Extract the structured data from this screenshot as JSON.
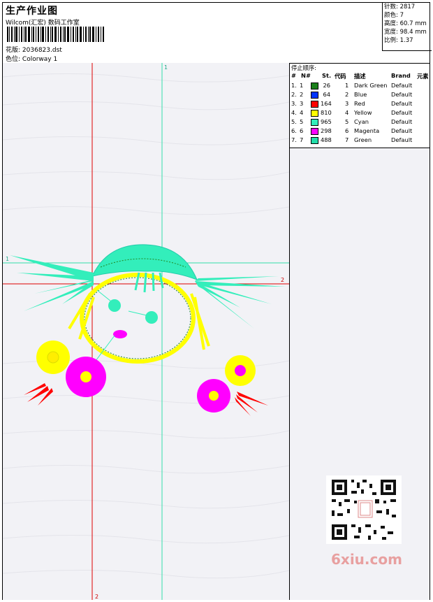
{
  "header": {
    "title": "生产作业图",
    "company": "Wilcom(汇宏) 数码工作室",
    "design_label": "花版:",
    "design_file": "2036823.dst",
    "colorway_label": "色位:",
    "colorway": "Colorway 1"
  },
  "stats": {
    "stitches_label": "针数:",
    "stitches": "2817",
    "colors_label": "颜色:",
    "colors": "7",
    "height_label": "高度:",
    "height": "60.7 mm",
    "width_label": "宽度:",
    "width": "98.4 mm",
    "ratio_label": "比例:",
    "ratio": "1.37"
  },
  "guides": {
    "h1_label": "1",
    "h2_label": "2",
    "v1_label": "1",
    "v2_label": "2"
  },
  "legend": {
    "title": "停止顺序:",
    "headers": {
      "hash": "#",
      "n": "N#",
      "st": "St.",
      "code": "代码",
      "desc": "描述",
      "brand": "Brand",
      "elem": "元素"
    },
    "rows": [
      {
        "num": "1.",
        "n": "1",
        "color": "#1a7f1a",
        "st": "26",
        "code": "1",
        "desc": "Dark Green",
        "brand": "Default"
      },
      {
        "num": "2.",
        "n": "2",
        "color": "#0033ff",
        "st": "64",
        "code": "2",
        "desc": "Blue",
        "brand": "Default"
      },
      {
        "num": "3.",
        "n": "3",
        "color": "#ff0000",
        "st": "164",
        "code": "3",
        "desc": "Red",
        "brand": "Default"
      },
      {
        "num": "4.",
        "n": "4",
        "color": "#ffff00",
        "st": "810",
        "code": "4",
        "desc": "Yellow",
        "brand": "Default"
      },
      {
        "num": "5.",
        "n": "5",
        "color": "#33eebb",
        "st": "965",
        "code": "5",
        "desc": "Cyan",
        "brand": "Default"
      },
      {
        "num": "6.",
        "n": "6",
        "color": "#ff00ff",
        "st": "298",
        "code": "6",
        "desc": "Magenta",
        "brand": "Default"
      },
      {
        "num": "7.",
        "n": "7",
        "color": "#22ddaa",
        "st": "488",
        "code": "7",
        "desc": "Green",
        "brand": "Default"
      }
    ]
  },
  "watermark": "6xiu.com"
}
